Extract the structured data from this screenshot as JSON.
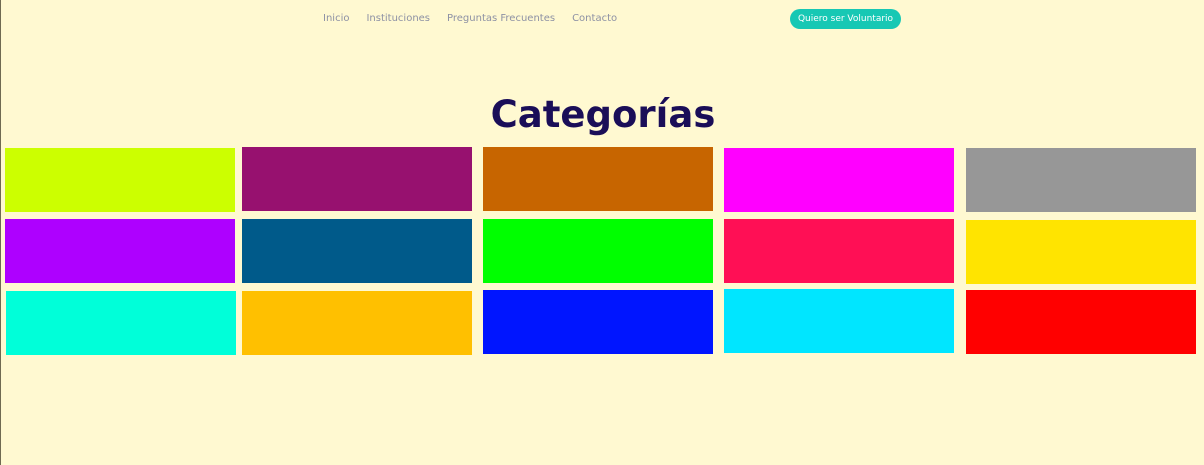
{
  "nav": {
    "items": [
      {
        "label": "Inicio"
      },
      {
        "label": "Instituciones"
      },
      {
        "label": "Preguntas Frecuentes"
      },
      {
        "label": "Contacto"
      }
    ],
    "cta_label": "Quiero ser Voluntario"
  },
  "page": {
    "title": "Categorías"
  },
  "colors": {
    "background": "#fff9d1",
    "title": "#1a0e58",
    "nav_text": "#8d91a4",
    "cta": "#17c8b4"
  },
  "categories": [
    {
      "color": "#ccff00"
    },
    {
      "color": "#97116f"
    },
    {
      "color": "#c76500"
    },
    {
      "color": "#ff00ff"
    },
    {
      "color": "#979797"
    },
    {
      "color": "#ae00ff"
    },
    {
      "color": "#005a8a"
    },
    {
      "color": "#00ff00"
    },
    {
      "color": "#ff0f55"
    },
    {
      "color": "#ffe400"
    },
    {
      "color": "#00ffd9"
    },
    {
      "color": "#ffc000"
    },
    {
      "color": "#0015ff"
    },
    {
      "color": "#00e6ff"
    },
    {
      "color": "#ff0000"
    }
  ]
}
